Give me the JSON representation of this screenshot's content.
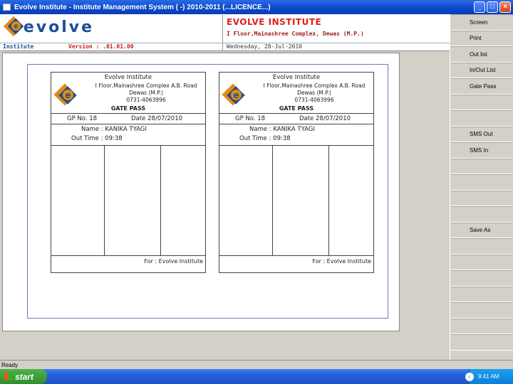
{
  "window": {
    "title": "Evolve Institute - Institute Management System ( -) 2010-2011 (...LICENCE...)",
    "minimize": "_",
    "maximize": "□",
    "close": "×"
  },
  "header": {
    "logo_text": "evolve",
    "logo_letter": "e",
    "institute_name": "EVOLVE INSTITUTE",
    "institute_address": "I Floor,Mainashree Complex, Dewas (M.P.)",
    "label": "Institute",
    "version": "Version : .01.01.00",
    "date": "Wednesday, 28-Jul-2010"
  },
  "side_buttons": [
    {
      "label": "Screen"
    },
    {
      "label": "Print"
    },
    {
      "label": "Out list"
    },
    {
      "label": "In/Out List"
    },
    {
      "label": "Gate Pass"
    },
    {
      "label": ""
    },
    {
      "label": ""
    },
    {
      "label": "SMS Out"
    },
    {
      "label": "SMS In"
    },
    {
      "label": ""
    },
    {
      "label": ""
    },
    {
      "label": ""
    },
    {
      "label": ""
    },
    {
      "label": "Save As"
    },
    {
      "label": ""
    },
    {
      "label": ""
    },
    {
      "label": ""
    },
    {
      "label": ""
    },
    {
      "label": ""
    },
    {
      "label": ""
    },
    {
      "label": ""
    }
  ],
  "pass": {
    "institute": "Evolve Institute",
    "address_line1": "I Floor,Mainashree Complex A.B. Road",
    "address_line2": "Dewas (M.P.)",
    "phone": "0731-4063996",
    "title": "GATE PASS",
    "gp_no": "GP No. 18",
    "date": "Date 28/07/2010",
    "name": "Name : KANIKA  TYAGI",
    "out_time": "Out Time : 09:38",
    "footer": "For  :  Evolve Institute"
  },
  "status": {
    "text": "Ready"
  },
  "taskbar": {
    "start": "start",
    "clock": "9:41 AM"
  }
}
